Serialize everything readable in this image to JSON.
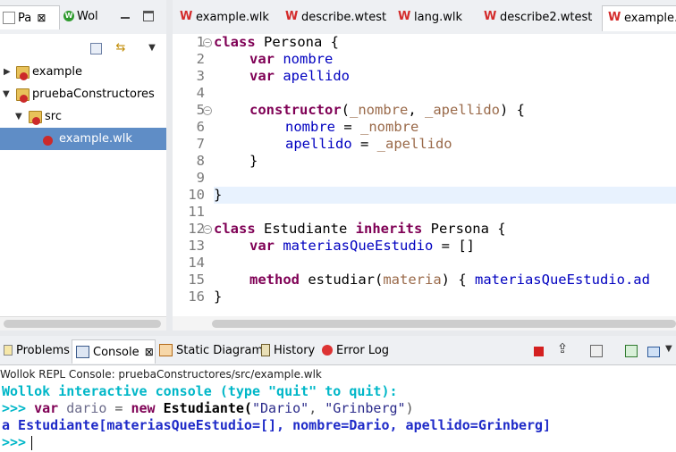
{
  "left_panel": {
    "tabs": [
      {
        "label": "Pa",
        "close": "⊠"
      },
      {
        "label": "Wol"
      }
    ],
    "tree": [
      {
        "label": "example",
        "expanded": false
      },
      {
        "label": "pruebaConstructores",
        "expanded": true
      },
      {
        "label": "src",
        "expanded": true
      },
      {
        "label": "example.wlk",
        "selected": true
      }
    ]
  },
  "editor": {
    "tabs": [
      {
        "label": "example.wlk"
      },
      {
        "label": "describe.wtest"
      },
      {
        "label": "lang.wlk"
      },
      {
        "label": "describe2.wtest"
      },
      {
        "label": "example.w",
        "active": true
      }
    ],
    "line_numbers": [
      "1",
      "2",
      "3",
      "4",
      "5",
      "6",
      "7",
      "8",
      "9",
      "10",
      "11",
      "12",
      "13",
      "14",
      "15",
      "16"
    ],
    "current_line": 10,
    "code": {
      "l1": {
        "kw": "class",
        "rest": " Persona {"
      },
      "l2": {
        "kw": "var",
        "name": "nombre"
      },
      "l3": {
        "kw": "var",
        "name": "apellido"
      },
      "l5": {
        "kw": "constructor",
        "p1": "_nombre",
        "p2": "_apellido",
        "open": "(",
        "sep": ", ",
        "close": ") {"
      },
      "l6": {
        "name": "nombre",
        "eq": " = ",
        "val": "_nombre"
      },
      "l7": {
        "name": "apellido",
        "eq": " = ",
        "val": "_apellido"
      },
      "l8": "}",
      "l10": "}",
      "l12": {
        "kw": "class",
        "mid": " Estudiante ",
        "kw2": "inherits",
        "rest": " Persona {"
      },
      "l13": {
        "kw": "var",
        "name": "materiasQueEstudio",
        "rest": " = []"
      },
      "l15": {
        "kw": "method",
        "mid": " estudiar(",
        "p": "materia",
        "rest": ") { ",
        "name": "materiasQueEstudio",
        "tail": ".ad"
      },
      "l16": "}"
    }
  },
  "bottom_panel": {
    "tabs": [
      {
        "label": "Problems"
      },
      {
        "label": "Console",
        "active": true,
        "close": "⊠"
      },
      {
        "label": "Static Diagram"
      },
      {
        "label": "History"
      },
      {
        "label": "Error Log"
      }
    ],
    "console_title": "Wollok REPL Console: pruebaConstructores/src/example.wlk",
    "lines": {
      "banner": "Wollok interactive console (type \"quit\" to quit):",
      "cmd_prompt": ">>> ",
      "cmd_var": "var",
      "cmd_name": " dario",
      "cmd_eq": " = ",
      "cmd_new": "new",
      "cmd_class": " Estudiante(",
      "cmd_arg1": "\"Dario\"",
      "cmd_comma": ", ",
      "cmd_arg2": "\"Grinberg\"",
      "cmd_close": ")",
      "result": "a Estudiante[materiasQueEstudio=[], nombre=Dario, apellido=Grinberg]",
      "prompt": ">>>"
    }
  },
  "colors": {
    "keyword": "#7f0055",
    "variable": "#0000c0",
    "console_cyan": "#00b7c8",
    "console_blue": "#1e2ac8",
    "selection": "#5f8dc6"
  }
}
